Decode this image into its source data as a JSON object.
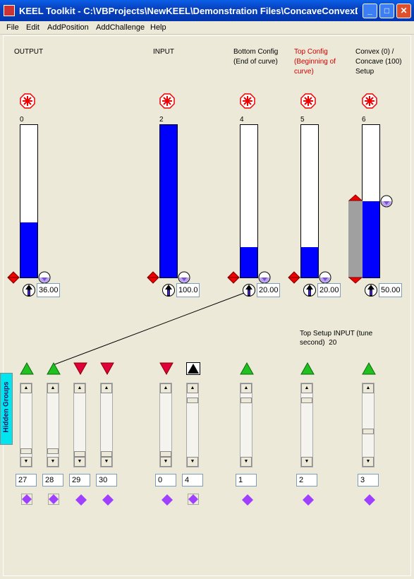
{
  "window": {
    "title": "KEEL Toolkit - C:\\VBProjects\\NewKEEL\\Demonstration Files\\ConcaveConvexD..."
  },
  "menu": [
    "File",
    "Edit",
    "AddPosition",
    "AddChallenge",
    "Help"
  ],
  "columns": [
    {
      "label": "OUTPUT",
      "number": "0",
      "value": "36.00",
      "fill": 0.36
    },
    {
      "label": "INPUT",
      "number": "2",
      "value": "100.0",
      "fill": 1.0
    },
    {
      "label": "Bottom Config\n(End of curve)",
      "number": "4",
      "value": "20.00",
      "fill": 0.2
    },
    {
      "label": "Top Config\n(Beginning of\ncurve)",
      "number": "5",
      "value": "20.00",
      "fill": 0.2,
      "color": "#d00000"
    },
    {
      "label": "Convex (0) /\nConcave (100)\nSetup",
      "number": "6",
      "value": "50.00",
      "fill": 0.5
    }
  ],
  "annotation": "Top Setup INPUT (tune\nsecond)  20",
  "side_tab": "Hidden Groups",
  "hidden_groups": [
    {
      "value": "27",
      "tri": "up-green"
    },
    {
      "value": "28",
      "tri": "up-green"
    },
    {
      "value": "29",
      "tri": "down-red"
    },
    {
      "value": "30",
      "tri": "down-red"
    },
    {
      "value": "0",
      "tri": "down-red"
    },
    {
      "value": "4",
      "tri": "up-black"
    },
    {
      "value": "1",
      "tri": "up-green"
    },
    {
      "value": "2",
      "tri": "up-green"
    },
    {
      "value": "3",
      "tri": "up-green"
    }
  ],
  "colors": {
    "fill": "#0000FF",
    "title_bar": "#0842C0",
    "side_tab": "#00E5EE"
  }
}
